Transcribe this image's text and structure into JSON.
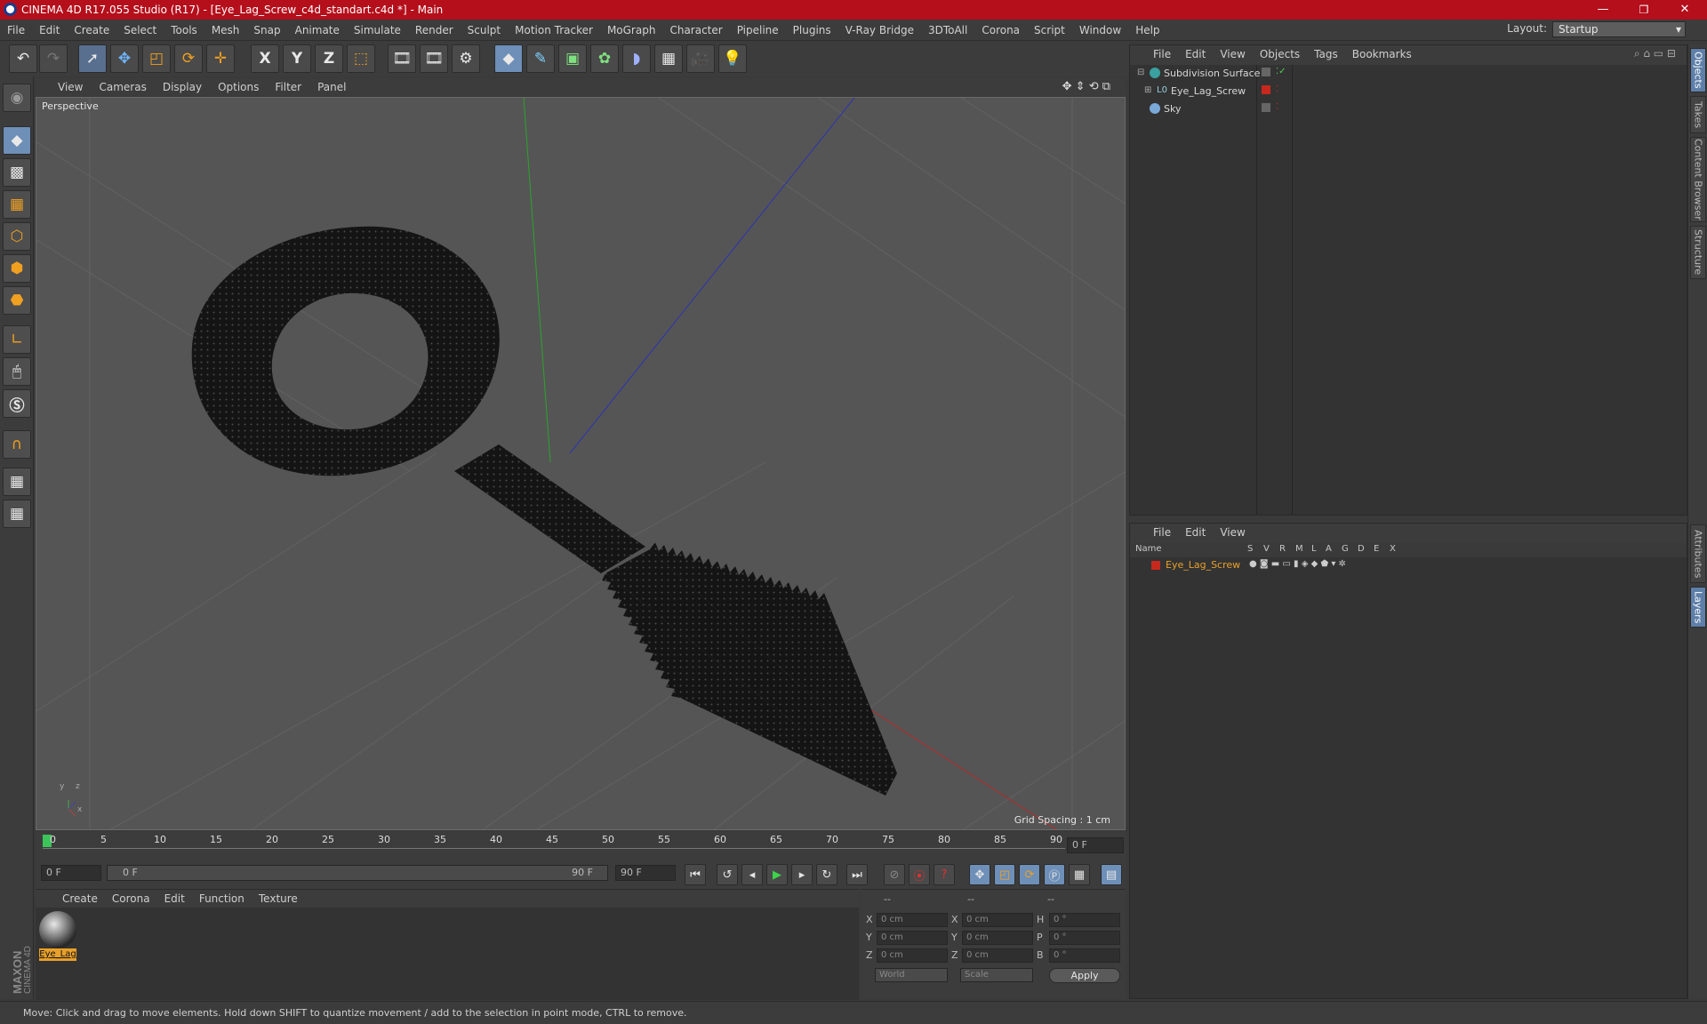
{
  "window": {
    "title": "CINEMA 4D R17.055 Studio (R17) - [Eye_Lag_Screw_c4d_standart.c4d *] - Main",
    "minimize": "—",
    "maximize": "❐",
    "close": "✕"
  },
  "menubar": [
    "File",
    "Edit",
    "Create",
    "Select",
    "Tools",
    "Mesh",
    "Snap",
    "Animate",
    "Simulate",
    "Render",
    "Sculpt",
    "Motion Tracker",
    "MoGraph",
    "Character",
    "Pipeline",
    "Plugins",
    "V-Ray Bridge",
    "3DToAll",
    "Corona",
    "Script",
    "Window",
    "Help"
  ],
  "layout": {
    "label": "Layout:",
    "value": "Startup"
  },
  "toolbar": {
    "icons": [
      "undo-icon",
      "redo-icon",
      "live-select-icon",
      "move-icon",
      "scale-icon",
      "rotate-icon",
      "create-icon",
      "x-axis-icon",
      "y-axis-icon",
      "z-axis-icon",
      "coordinate-system-icon",
      "render-view-icon",
      "render-picture-viewer-icon",
      "edit-render-settings-icon",
      "cube-icon",
      "pen-icon",
      "subdivision-icon",
      "cloner-icon",
      "deformer-icon",
      "floor-icon",
      "camera-icon",
      "light-icon"
    ],
    "axis_x": "X",
    "axis_y": "Y",
    "axis_z": "Z"
  },
  "viewport": {
    "menu": [
      "View",
      "Cameras",
      "Display",
      "Options",
      "Filter",
      "Panel"
    ],
    "label": "Perspective",
    "grid_spacing": "Grid Spacing : 1 cm",
    "axis_x": "x",
    "axis_y": "y",
    "axis_z": "z"
  },
  "timeline": {
    "ticks": [
      "0",
      "5",
      "10",
      "15",
      "20",
      "25",
      "30",
      "35",
      "40",
      "45",
      "50",
      "55",
      "60",
      "65",
      "70",
      "75",
      "80",
      "85",
      "90"
    ],
    "current_frame": "0 F",
    "start": "0 F",
    "range_start": "0 F",
    "range_end": "90 F",
    "end": "90 F"
  },
  "material_panel": {
    "menu": [
      "Create",
      "Corona",
      "Edit",
      "Function",
      "Texture"
    ],
    "material_name": "Eye_Lag"
  },
  "coordinates": {
    "headers": [
      "--",
      "--",
      "--"
    ],
    "rows": [
      {
        "a": "X",
        "pos": "0 cm",
        "b": "X",
        "size": "0 cm",
        "c": "H",
        "rot": "0 °"
      },
      {
        "a": "Y",
        "pos": "0 cm",
        "b": "Y",
        "size": "0 cm",
        "c": "P",
        "rot": "0 °"
      },
      {
        "a": "Z",
        "pos": "0 cm",
        "b": "Z",
        "size": "0 cm",
        "c": "B",
        "rot": "0 °"
      }
    ],
    "mode": "World",
    "scale": "Scale",
    "apply": "Apply"
  },
  "object_manager": {
    "menu": [
      "File",
      "Edit",
      "View",
      "Objects",
      "Tags",
      "Bookmarks"
    ],
    "objects": [
      {
        "name": "Subdivision Surface"
      },
      {
        "name": "Eye_Lag_Screw"
      },
      {
        "name": "Sky"
      }
    ]
  },
  "layer_manager": {
    "menu": [
      "File",
      "Edit",
      "View"
    ],
    "columns": [
      "Name",
      "S",
      "V",
      "R",
      "M",
      "L",
      "A",
      "G",
      "D",
      "E",
      "X"
    ],
    "layers": [
      {
        "name": "Eye_Lag_Screw",
        "color": "#c8281e"
      }
    ]
  },
  "right_tabs": [
    "Objects",
    "Takes",
    "Content Browser",
    "Structure",
    "Attributes",
    "Layers"
  ],
  "maxon_logo": "MAXON CINEMA 4D",
  "status": "Move: Click and drag to move elements. Hold down SHIFT to quantize movement / add to the selection in point mode, CTRL to remove.",
  "colors": {
    "title_bar": "#b40f1b",
    "accent": "#6d8fb8",
    "layer_name": "#e8a02a"
  }
}
